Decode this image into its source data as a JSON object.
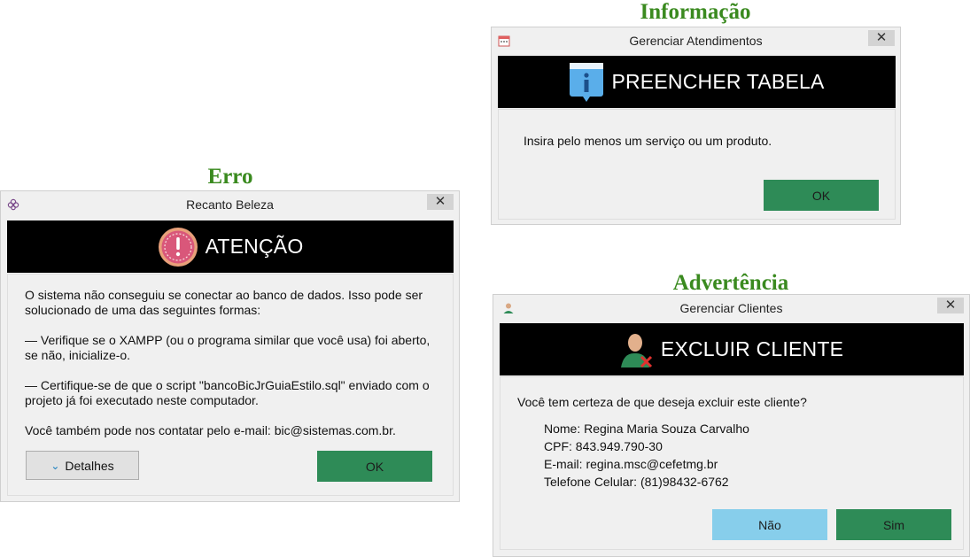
{
  "captions": {
    "info": "Informação",
    "error": "Erro",
    "warning": "Advertência"
  },
  "error_dialog": {
    "window_title": "Recanto Beleza",
    "close": "✕",
    "header": "ATENÇÃO",
    "icon": "alert-icon",
    "lines": [
      "O sistema não conseguiu se conectar ao banco de dados. Isso pode ser",
      "solucionado de uma das seguintes formas:",
      "— Verifique se o XAMPP (ou o programa similar que você usa) foi aberto,",
      "se não, inicialize-o.",
      "— Certifique-se de que o script \"bancoBicJrGuiaEstilo.sql\" enviado com o",
      "projeto já foi executado neste computador.",
      "Você também pode nos contatar pelo e-mail: bic@sistemas.com.br."
    ],
    "details_label": "Detalhes",
    "ok_label": "OK"
  },
  "info_dialog": {
    "window_title": "Gerenciar Atendimentos",
    "close": "✕",
    "header": "PREENCHER TABELA",
    "icon": "info-icon",
    "message": "Insira pelo menos um serviço ou um produto.",
    "ok_label": "OK"
  },
  "warning_dialog": {
    "window_title": "Gerenciar Clientes",
    "close": "✕",
    "header": "EXCLUIR CLIENTE",
    "icon": "remove-user-icon",
    "question": "Você tem certeza de que deseja excluir este cliente?",
    "details": [
      "Nome: Regina Maria Souza Carvalho",
      "CPF: 843.949.790-30",
      "E-mail: regina.msc@cefetmg.br",
      "Telefone Celular: (81)98432-6762"
    ],
    "no_label": "Não",
    "yes_label": "Sim"
  },
  "colors": {
    "caption": "#3a8a1f",
    "header_bg": "#000000",
    "ok_green": "#2e8b57",
    "no_blue": "#87ceeb"
  }
}
